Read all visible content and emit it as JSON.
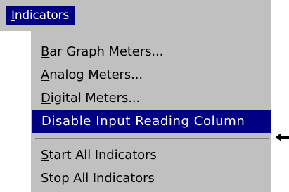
{
  "menu": {
    "title": "Indicators",
    "title_mnemonic": "I",
    "title_rest": "ndicators"
  },
  "items": [
    {
      "label": "Bar Graph Meters...",
      "mnemonic": "B",
      "rest": "ar Graph Meters..."
    },
    {
      "label": "Analog Meters...",
      "mnemonic": "A",
      "rest": "nalog Meters..."
    },
    {
      "label": "Digital Meters...",
      "mnemonic": "D",
      "rest": "igital Meters..."
    },
    {
      "label": "Disable Input Reading Column",
      "selected": true
    },
    {
      "label": "Start All Indicators",
      "mnemonic": "S",
      "rest": "tart All Indicators"
    },
    {
      "label": "Stop All Indicators",
      "before": "Sto",
      "mnemonic": "p",
      "rest": " All Indicators"
    }
  ],
  "colors": {
    "menu_face": "#c0c0c0",
    "highlight": "#000080",
    "highlight_text": "#ffffff",
    "text": "#000000"
  },
  "annotation": {
    "icon": "left-arrow-icon"
  }
}
